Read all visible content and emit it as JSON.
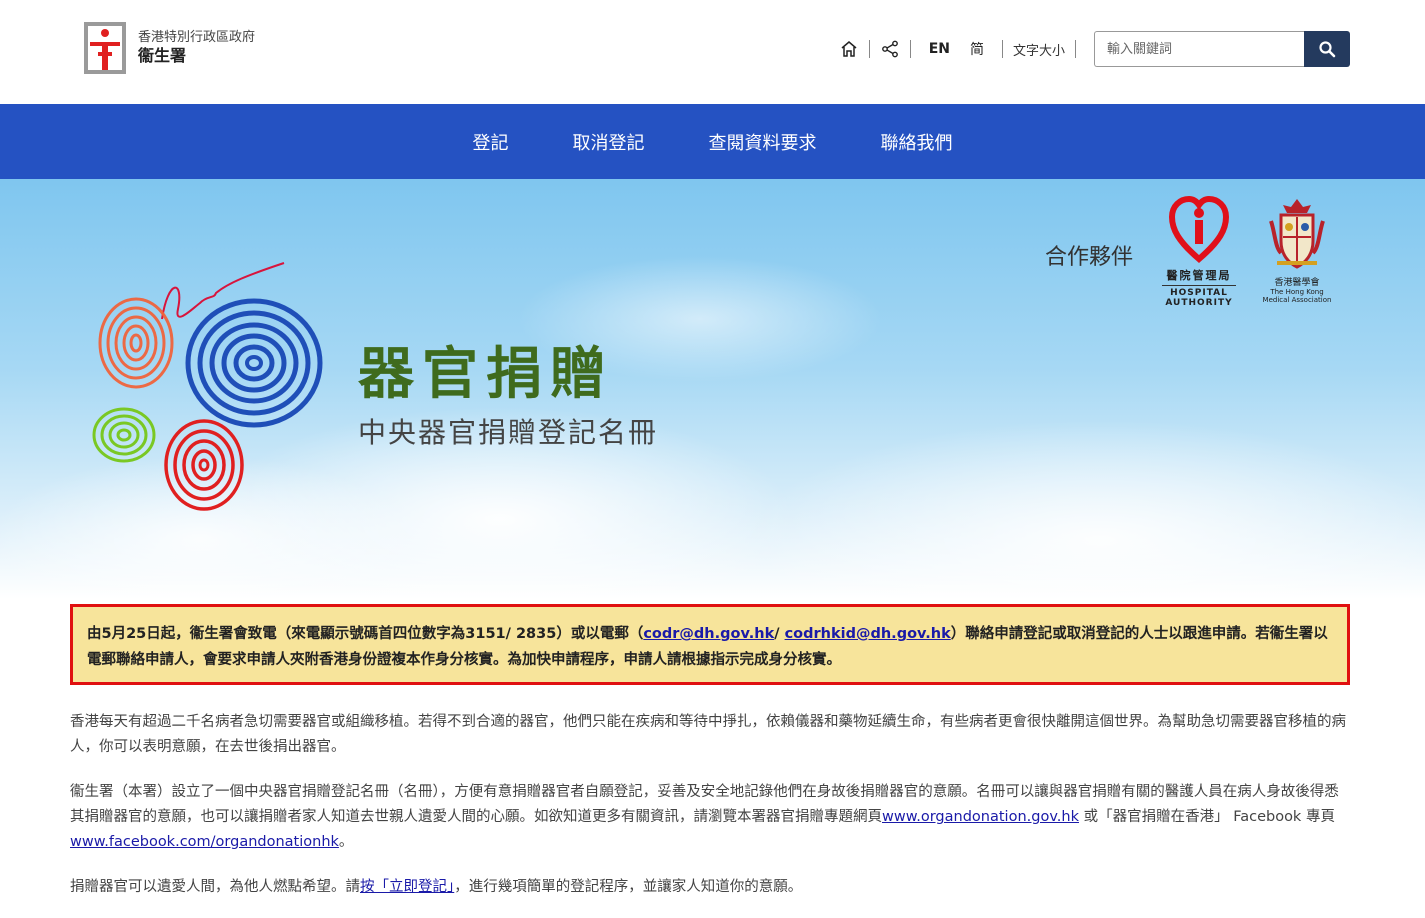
{
  "header": {
    "logo_line1": "香港特別行政區政府",
    "logo_line2": "衞生署",
    "lang_en": "EN",
    "lang_sc": "简",
    "font_size": "文字大小",
    "search_placeholder": "輸入關鍵詞"
  },
  "nav": {
    "items": [
      {
        "label": "登記"
      },
      {
        "label": "取消登記"
      },
      {
        "label": "查閱資料要求"
      },
      {
        "label": "聯絡我們"
      }
    ]
  },
  "banner": {
    "partner_label": "合作夥伴",
    "ha_cn": "醫院管理局",
    "ha_en1": "HOSPITAL",
    "ha_en2": "AUTHORITY",
    "hkma_cn": "香港醫學會",
    "hkma_en1": "The Hong Kong",
    "hkma_en2": "Medical Association",
    "title": "器官捐贈",
    "subtitle": "中央器官捐贈登記名冊"
  },
  "notice": {
    "part1": "由5月25日起，衞生署會致電（來電顯示號碼首四位數字為3151/ 2835）或以電郵（",
    "email1": "codr@dh.gov.hk",
    "sep": "/ ",
    "email2": "codrhkid@dh.gov.hk",
    "part2": "）聯絡申請登記或取消登記的人士以跟進申請。若衞生署以電郵聯絡申請人，會要求申請人夾附香港身份證複本作身分核實。為加快申請程序，申請人請根據指示完成身分核實。"
  },
  "content": {
    "p1": "香港每天有超過二千名病者急切需要器官或組織移植。若得不到合適的器官，他們只能在疾病和等待中掙扎，依賴儀器和藥物延續生命，有些病者更會很快離開這個世界。為幫助急切需要器官移植的病人，你可以表明意願，在去世後捐出器官。",
    "p2_a": "衞生署（本署）設立了一個中央器官捐贈登記名冊（名冊），方便有意捐贈器官者自願登記，妥善及安全地記錄他們在身故後捐贈器官的意願。名冊可以讓與器官捐贈有關的醫護人員在病人身故後得悉其捐贈器官的意願，也可以讓捐贈者家人知道去世親人遺愛人間的心願。如欲知道更多有關資訊，請瀏覽本署器官捐贈專題網頁",
    "p2_link1": "www.organdonation.gov.hk",
    "p2_b": " 或「器官捐贈在香港」 Facebook 專頁 ",
    "p2_link2": "www.facebook.com/organdonationhk",
    "p2_c": "。",
    "p3_a": "捐贈器官可以遺愛人間，為他人燃點希望。請",
    "p3_link": "按「立即登記」",
    "p3_b": "，進行幾項簡單的登記程序，並讓家人知道你的意願。"
  }
}
